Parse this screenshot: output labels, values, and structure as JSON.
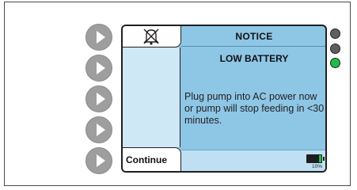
{
  "screen": {
    "title": "NOTICE",
    "subtitle": "LOW BATTERY",
    "message": "Plug pump into AC power now or pump will stop feeding in <30 minutes.",
    "continue_label": "Continue",
    "battery": {
      "percent_label": "10%",
      "level": 0.1
    }
  },
  "icons": {
    "alarm_silenced": "alarm-silenced-icon",
    "battery": "battery-icon"
  },
  "side_buttons": [
    "arrow",
    "arrow",
    "arrow",
    "arrow",
    "arrow"
  ],
  "status_leds": [
    {
      "name": "led-1",
      "color": "#5f5f5f"
    },
    {
      "name": "led-2",
      "color": "#5f5f5f"
    },
    {
      "name": "led-3",
      "color": "#1fbd48"
    }
  ],
  "colors": {
    "screen_bg": "#8ec6e6",
    "accent_green": "#1fbd48"
  }
}
